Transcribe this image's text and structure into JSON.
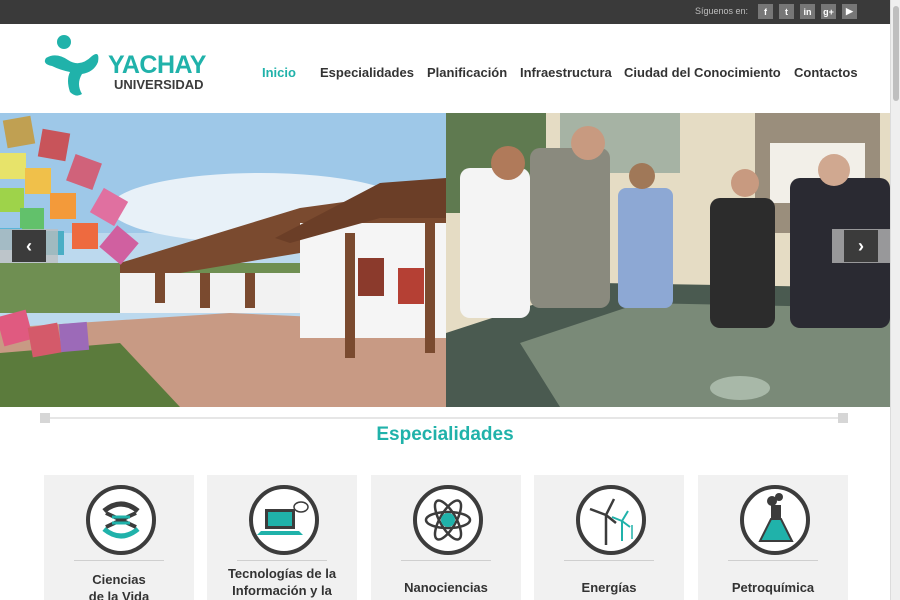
{
  "topbar": {
    "follow_label": "Síguenos en:",
    "socials": [
      {
        "icon": "facebook-icon",
        "glyph": "f"
      },
      {
        "icon": "twitter-icon",
        "glyph": "t"
      },
      {
        "icon": "linkedin-icon",
        "glyph": "in"
      },
      {
        "icon": "googleplus-icon",
        "glyph": "g+"
      },
      {
        "icon": "youtube-icon",
        "glyph": "▶"
      }
    ]
  },
  "logo": {
    "word1": "YACHAY",
    "word2": "UNIVERSIDAD",
    "icon": "yachay-logo-icon"
  },
  "nav": {
    "items": [
      {
        "label": "Inicio",
        "active": true
      },
      {
        "label": "Especialidades",
        "active": false
      },
      {
        "label": "Planificación",
        "active": false
      },
      {
        "label": "Infraestructura",
        "active": false
      },
      {
        "label": "Ciudad del Conocimiento",
        "active": false
      },
      {
        "label": "Contactos",
        "active": false
      }
    ]
  },
  "hero": {
    "prev_glyph": "‹",
    "next_glyph": "›",
    "left_image": "campus-buildings-photo",
    "right_image": "scale-model-visit-photo"
  },
  "specialties": {
    "title": "Especialidades",
    "cards": [
      {
        "label": "Ciencias\nde la Vida",
        "icon": "dna-icon"
      },
      {
        "label": "Tecnologías de la\nInformación y la",
        "icon": "laptop-icon"
      },
      {
        "label": "Nanociencias",
        "icon": "atom-icon"
      },
      {
        "label": "Energías",
        "icon": "wind-turbine-icon"
      },
      {
        "label": "Petroquímica",
        "icon": "flask-icon"
      }
    ]
  },
  "colors": {
    "accent": "#20b2aa",
    "dark": "#3a3a3a",
    "card_bg": "#f1f1f1"
  }
}
